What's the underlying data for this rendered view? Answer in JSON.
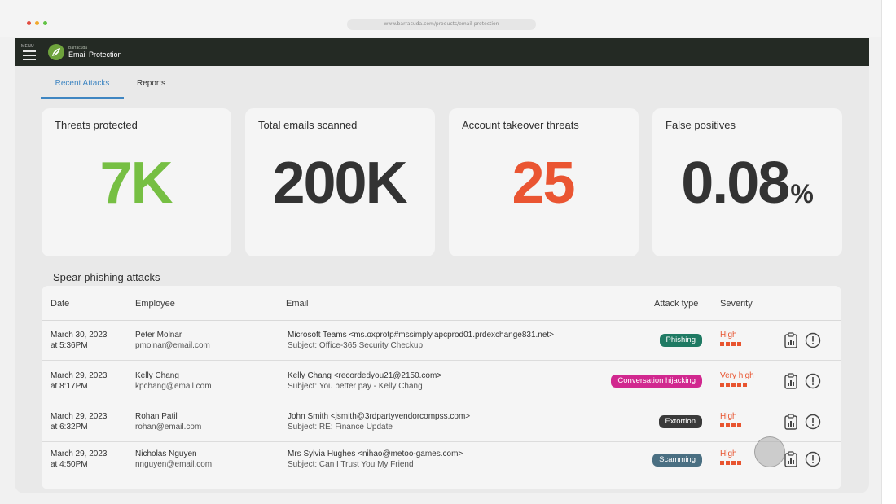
{
  "browser": {
    "url": "www.barracuda.com/products/email-protection",
    "dot_colors": [
      "#e24b3f",
      "#f1a92c",
      "#61c345"
    ]
  },
  "header": {
    "menu_label": "MENU",
    "brand_small": "Barracuda",
    "product_name": "Email Protection",
    "brand_color": "#6ea33c",
    "bar_color": "#242a24"
  },
  "tabs": [
    {
      "label": "Recent Attacks",
      "active": true
    },
    {
      "label": "Reports",
      "active": false
    }
  ],
  "stats": [
    {
      "label": "Threats protected",
      "value": "7K",
      "suffix": "",
      "color": "#76bf43"
    },
    {
      "label": "Total emails scanned",
      "value": "200K",
      "suffix": "",
      "color": "#333333"
    },
    {
      "label": "Account takeover threats",
      "value": "25",
      "suffix": "",
      "color": "#ea5532"
    },
    {
      "label": "False positives",
      "value": "0.08",
      "suffix": "%",
      "color": "#333333"
    }
  ],
  "table": {
    "title": "Spear phishing attacks",
    "columns": {
      "date": "Date",
      "employee": "Employee",
      "email": "Email",
      "attack_type": "Attack type",
      "severity": "Severity"
    },
    "rows": [
      {
        "date": "March 30, 2023",
        "time": "at 5:36PM",
        "employee_name": "Peter Molnar",
        "employee_email": "pmolnar@email.com",
        "sender": "Microsoft Teams <ms.oxprotp#mssimply.apcprod01.prdexchange831.net>",
        "subject": "Subject: Office-365 Security Checkup",
        "attack_type": "Phishing",
        "attack_color": "#1f7a63",
        "severity": "High",
        "severity_level": 4,
        "icons": [
          "report-icon",
          "alert-circle-icon"
        ]
      },
      {
        "date": "March 29, 2023",
        "time": "at 8:17PM",
        "employee_name": "Kelly Chang",
        "employee_email": "kpchang@email.com",
        "sender": "Kelly Chang <recordedyou21@2150.com>",
        "subject": "Subject: You better pay - Kelly Chang",
        "attack_type": "Conversation hijacking",
        "attack_color": "#d1288f",
        "severity": "Very high",
        "severity_level": 5,
        "icons": [
          "report-icon",
          "alert-circle-icon"
        ]
      },
      {
        "date": "March 29, 2023",
        "time": "at 6:32PM",
        "employee_name": "Rohan Patil",
        "employee_email": "rohan@email.com",
        "sender": "John Smith <jsmith@3rdpartyvendorcompss.com>",
        "subject": "Subject: RE: Finance Update",
        "attack_type": "Extortion",
        "attack_color": "#3a3a3a",
        "severity": "High",
        "severity_level": 4,
        "icons": [
          "report-icon",
          "alert-circle-icon"
        ]
      },
      {
        "date": "March 29, 2023",
        "time": "at 4:50PM",
        "employee_name": "Nicholas Nguyen",
        "employee_email": "nnguyen@email.com",
        "sender": "Mrs Sylvia Hughes <nihao@metoo-games.com>",
        "subject": "Subject: Can I Trust You My Friend",
        "attack_type": "Scamming",
        "attack_color": "#4a6f82",
        "severity": "High",
        "severity_level": 4,
        "icons": [
          "report-icon",
          "alert-circle-icon"
        ]
      }
    ]
  }
}
